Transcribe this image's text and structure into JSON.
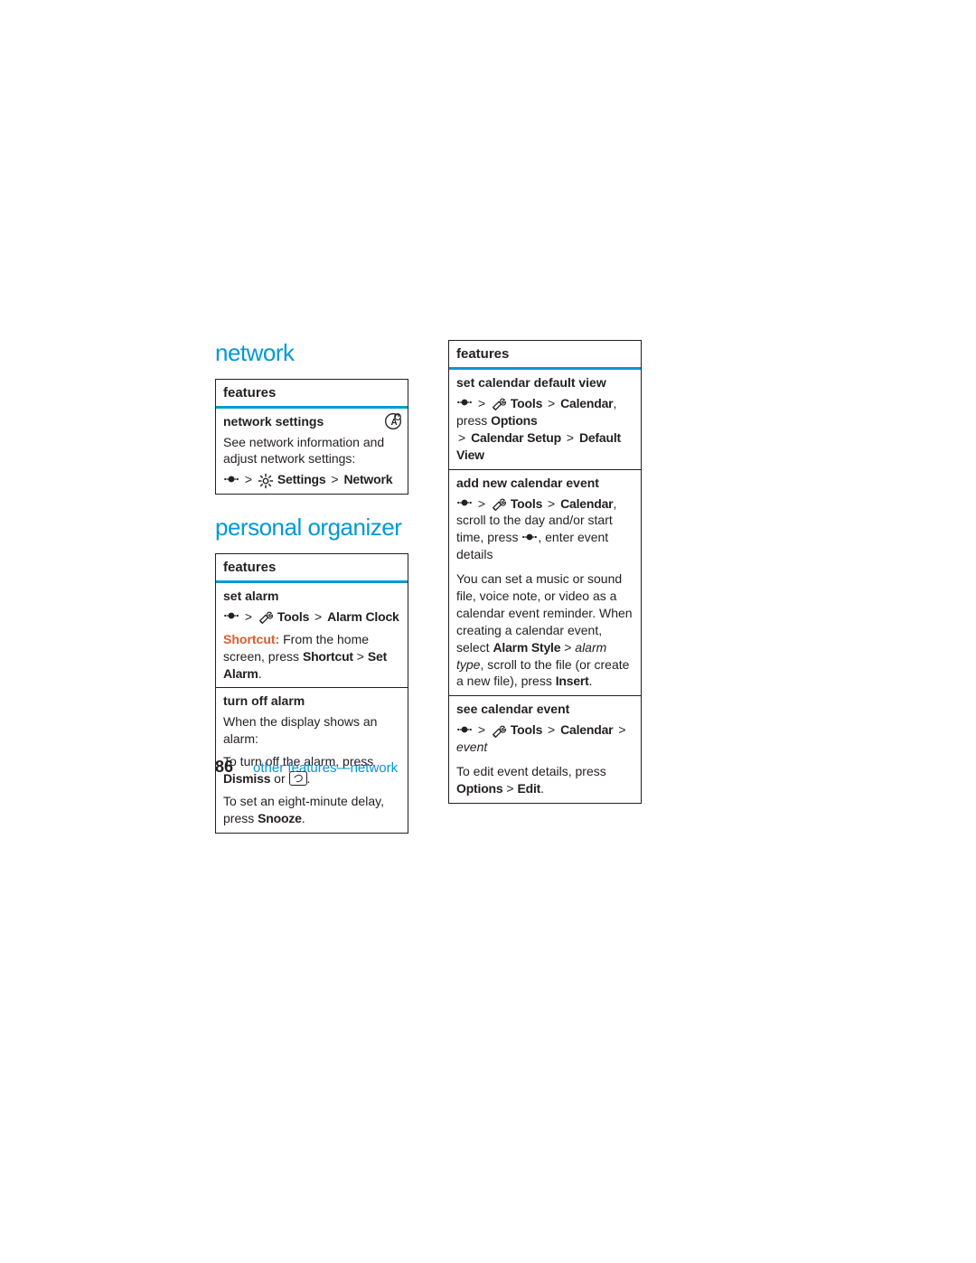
{
  "headings": {
    "network": "network",
    "personal_organizer": "personal organizer"
  },
  "labels": {
    "features": "features",
    "sep": ">"
  },
  "left_box1": {
    "row1": {
      "title": "network settings",
      "desc": "See network information and adjust network settings:",
      "path_settings": "Settings",
      "path_network": "Network"
    }
  },
  "left_box2": {
    "row1": {
      "title": "set alarm",
      "path_tools": "Tools",
      "path_alarm": "Alarm Clock",
      "shortcut_label": "Shortcut:",
      "shortcut_text": " From the home screen, press ",
      "shortcut_path1": "Shortcut",
      "shortcut_path2": "Set Alarm",
      "period": "."
    },
    "row2": {
      "title": "turn off alarm",
      "line1": "When the display shows an alarm:",
      "line2a": "To turn off the alarm, press ",
      "dismiss": "Dismiss",
      "line2b": " or ",
      "line2c": ".",
      "line3a": "To set an eight-minute delay, press ",
      "snooze": "Snooze",
      "line3b": "."
    }
  },
  "right_box": {
    "row1": {
      "title": "set calendar default view",
      "path_tools": "Tools",
      "path_calendar": "Calendar",
      "press_text": ", press ",
      "options": "Options",
      "path_setup": "Calendar Setup",
      "path_default": "Default View"
    },
    "row2": {
      "title": "add new calendar event",
      "path_tools": "Tools",
      "path_calendar": "Calendar",
      "text1": ", scroll to the day and/or start time, press ",
      "text2": ", enter event details",
      "para2a": "You can set a music or sound file, voice note, or video as a calendar event reminder. When creating a calendar event, select ",
      "alarm_style": "Alarm Style",
      "para2b": " > ",
      "alarm_type": "alarm type",
      "para2c": ", scroll to the file (or create a new file), press ",
      "insert": "Insert",
      "period": "."
    },
    "row3": {
      "title": "see calendar event",
      "path_tools": "Tools",
      "path_calendar": "Calendar",
      "event": "event",
      "edit_text1": "To edit event details, press ",
      "options": "Options",
      "edit": "Edit",
      "period": "."
    }
  },
  "footer": {
    "page": "86",
    "text": "other features—network"
  }
}
